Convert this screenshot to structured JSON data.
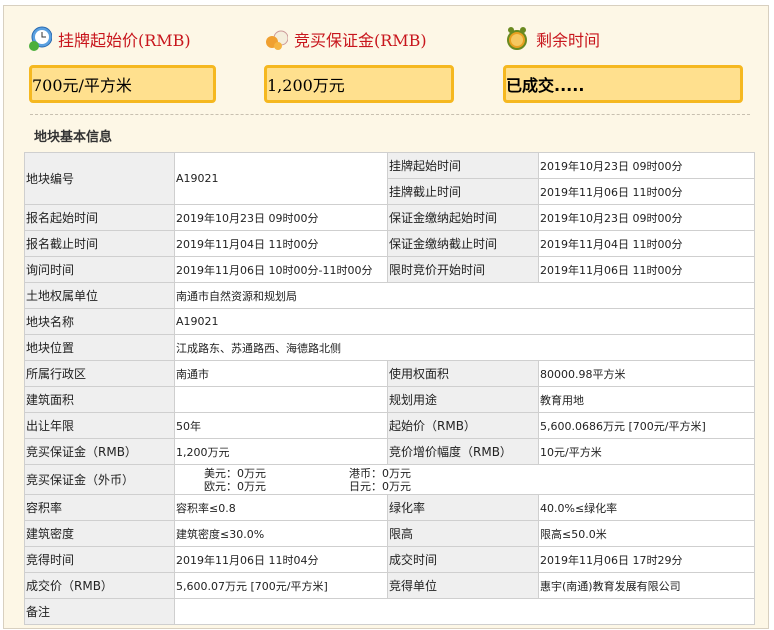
{
  "summary": {
    "start_price": {
      "title": "挂牌起始价(RMB)",
      "value": "700元/平方米",
      "icon": "clock-money-icon"
    },
    "deposit": {
      "title": "竞买保证金(RMB)",
      "value": "1,200万元",
      "icon": "money-bag-icon"
    },
    "remaining": {
      "title": "剩余时间",
      "value": "已成交.....",
      "icon": "alarm-clock-icon"
    }
  },
  "section_title": "地块基本信息",
  "table": {
    "r1": {
      "l": "地块编号",
      "v": "A19021",
      "l2": "挂牌起始时间",
      "v2": "2019年10月23日 09时00分",
      "l3": "挂牌截止时间",
      "v3": "2019年11月06日 11时00分"
    },
    "r2": {
      "l": "报名起始时间",
      "v": "2019年10月23日 09时00分",
      "l2": "保证金缴纳起始时间",
      "v2": "2019年10月23日 09时00分"
    },
    "r3": {
      "l": "报名截止时间",
      "v": "2019年11月04日 11时00分",
      "l2": "保证金缴纳截止时间",
      "v2": "2019年11月04日 11时00分"
    },
    "r4": {
      "l": "询问时间",
      "v": "2019年11月06日 10时00分-11时00分",
      "l2": "限时竞价开始时间",
      "v2": "2019年11月06日 11时00分"
    },
    "r5": {
      "l": "土地权属单位",
      "v": "南通市自然资源和规划局"
    },
    "r6": {
      "l": "地块名称",
      "v": "A19021"
    },
    "r7": {
      "l": "地块位置",
      "v": "江成路东、苏通路西、海德路北侧"
    },
    "r8": {
      "l": "所属行政区",
      "v": "南通市",
      "l2": "使用权面积",
      "v2": "80000.98平方米"
    },
    "r9": {
      "l": "建筑面积",
      "v": "",
      "l2": "规划用途",
      "v2": "教育用地"
    },
    "r10": {
      "l": "出让年限",
      "v": "50年",
      "l2": "起始价（RMB）",
      "v2": "5,600.0686万元 [700元/平方米]"
    },
    "r11": {
      "l": "竞买保证金（RMB）",
      "v": "1,200万元",
      "l2": "竞价增价幅度（RMB）",
      "v2": "10元/平方米"
    },
    "r12": {
      "l": "竞买保证金（外币）",
      "usd": "美元：0万元",
      "hkd": "港币：0万元",
      "eur": "欧元：0万元",
      "jpy": "日元：0万元"
    },
    "r13": {
      "l": "容积率",
      "v": "容积率≤0.8",
      "l2": "绿化率",
      "v2": "40.0%≤绿化率"
    },
    "r14": {
      "l": "建筑密度",
      "v": "建筑密度≤30.0%",
      "l2": "限高",
      "v2": "限高≤50.0米"
    },
    "r15": {
      "l": "竞得时间",
      "v": "2019年11月06日 11时04分",
      "l2": "成交时间",
      "v2": "2019年11月06日 17时29分"
    },
    "r16": {
      "l": "成交价（RMB）",
      "v": "5,600.07万元 [700元/平方米]",
      "l2": "竞得单位",
      "v2": "惠宇(南通)教育发展有限公司"
    },
    "r17": {
      "l": "备注",
      "v": ""
    }
  }
}
